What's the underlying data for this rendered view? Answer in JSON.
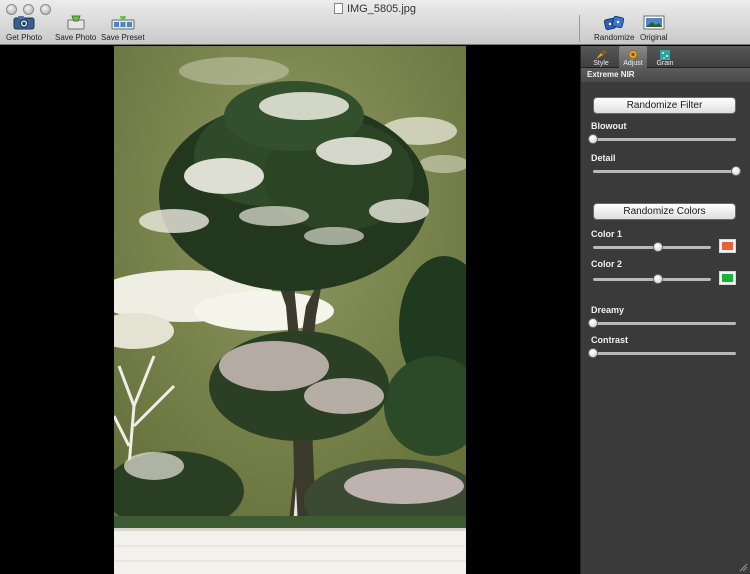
{
  "window": {
    "title": "IMG_5805.jpg"
  },
  "toolbar": {
    "get_photo": "Get Photo",
    "save_photo": "Save Photo",
    "save_preset": "Save Preset",
    "randomize": "Randomize",
    "original": "Original"
  },
  "panel": {
    "tabs": [
      {
        "label": "Style",
        "icon": "brush-icon"
      },
      {
        "label": "Adjust",
        "icon": "gear-icon"
      },
      {
        "label": "Grain",
        "icon": "grain-icon"
      }
    ],
    "active_tab": "Adjust",
    "preset_name": "Extreme NIR",
    "randomize_filter_label": "Randomize Filter",
    "randomize_colors_label": "Randomize Colors",
    "sliders": {
      "blowout": {
        "label": "Blowout",
        "value": 0.0
      },
      "detail": {
        "label": "Detail",
        "value": 1.0
      },
      "color1": {
        "label": "Color 1",
        "value": 0.55
      },
      "color2": {
        "label": "Color 2",
        "value": 0.55
      },
      "dreamy": {
        "label": "Dreamy",
        "value": 0.0
      },
      "contrast": {
        "label": "Contrast",
        "value": 0.0
      }
    },
    "color1_swatch": "#e8603a",
    "color2_swatch": "#19b33a"
  }
}
